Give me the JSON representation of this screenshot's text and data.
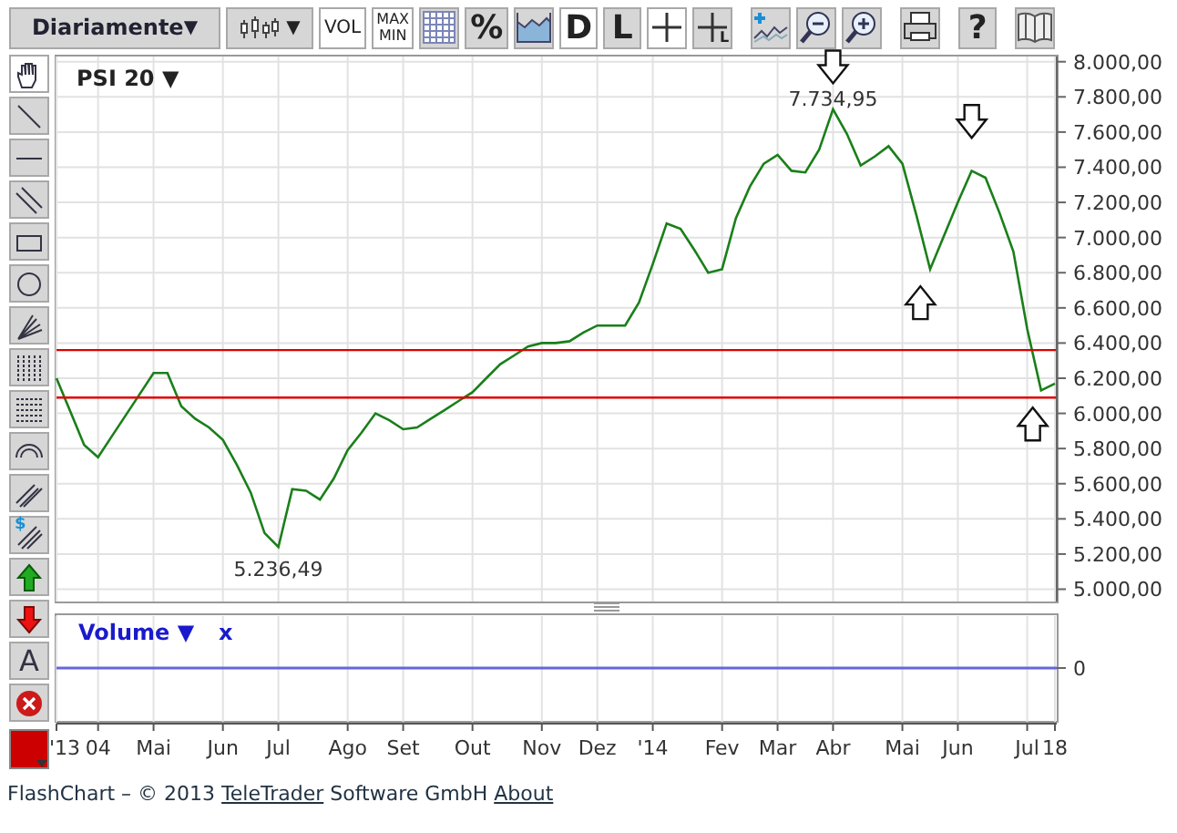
{
  "toolbar": [
    {
      "kind": "dropdown",
      "label": "Diariamente",
      "arrow": "▼",
      "on": false
    },
    {
      "kind": "chart_type",
      "arrow": "▼",
      "on": false
    },
    {
      "kind": "text",
      "label": "VOL",
      "on": true
    },
    {
      "kind": "text2",
      "label": "MAX",
      "label2": "MIN",
      "on": true
    },
    {
      "kind": "grid",
      "on": false
    },
    {
      "kind": "text",
      "label": "%",
      "on": false
    },
    {
      "kind": "area",
      "on": false
    },
    {
      "kind": "text",
      "label": "D",
      "on": true
    },
    {
      "kind": "text",
      "label": "L",
      "on": false
    },
    {
      "kind": "crosshair",
      "on": true
    },
    {
      "kind": "crosshair_l",
      "label": "L",
      "on": false
    },
    {
      "kind": "gap"
    },
    {
      "kind": "add_indicator",
      "on": false
    },
    {
      "kind": "zoom_out",
      "on": false
    },
    {
      "kind": "zoom_in",
      "on": false
    },
    {
      "kind": "gap"
    },
    {
      "kind": "print",
      "on": false
    },
    {
      "kind": "gap"
    },
    {
      "kind": "text",
      "label": "?",
      "on": false
    },
    {
      "kind": "gap"
    },
    {
      "kind": "book",
      "on": false
    }
  ],
  "drawing_tools": [
    {
      "kind": "hand",
      "selected": true
    },
    {
      "kind": "line",
      "selected": false
    },
    {
      "kind": "hline",
      "selected": false
    },
    {
      "kind": "channel",
      "selected": false
    },
    {
      "kind": "rect",
      "selected": false
    },
    {
      "kind": "circle",
      "selected": false
    },
    {
      "kind": "fan",
      "selected": false
    },
    {
      "kind": "vlines",
      "selected": false
    },
    {
      "kind": "hlines",
      "selected": false
    },
    {
      "kind": "arc",
      "selected": false
    },
    {
      "kind": "parallel",
      "selected": false
    },
    {
      "kind": "parallel_s",
      "label": "$",
      "selected": false
    },
    {
      "kind": "up",
      "selected": false
    },
    {
      "kind": "down",
      "selected": false
    },
    {
      "kind": "text",
      "label": "A",
      "selected": false
    },
    {
      "kind": "delete",
      "selected": false
    }
  ],
  "color_picker": {
    "color": "#cc0000"
  },
  "chart": {
    "title_arrow": "▼",
    "chart_data": {
      "type": "line",
      "ylim": [
        4930,
        8040
      ],
      "categories": [
        "'13",
        null,
        null,
        "04",
        null,
        null,
        null,
        "Mai",
        null,
        null,
        null,
        null,
        "Jun",
        null,
        null,
        null,
        "Jul",
        null,
        null,
        null,
        null,
        "Ago",
        null,
        null,
        null,
        "Set",
        null,
        null,
        null,
        null,
        "Out",
        null,
        null,
        null,
        null,
        "Nov",
        null,
        null,
        null,
        "Dez",
        null,
        null,
        null,
        "'14",
        null,
        null,
        null,
        null,
        "Fev",
        null,
        null,
        null,
        "Mar",
        null,
        null,
        null,
        "Abr",
        null,
        null,
        null,
        null,
        "Mai",
        null,
        null,
        null,
        "Jun",
        null,
        null,
        null,
        null,
        "Jul",
        null,
        "18"
      ],
      "yticks": [
        {
          "value": 8000,
          "label": "8.000,00"
        },
        {
          "value": 7800,
          "label": "7.800,00"
        },
        {
          "value": 7600,
          "label": "7.600,00"
        },
        {
          "value": 7400,
          "label": "7.400,00"
        },
        {
          "value": 7200,
          "label": "7.200,00"
        },
        {
          "value": 7000,
          "label": "7.000,00"
        },
        {
          "value": 6800,
          "label": "6.800,00"
        },
        {
          "value": 6600,
          "label": "6.600,00"
        },
        {
          "value": 6400,
          "label": "6.400,00"
        },
        {
          "value": 6200,
          "label": "6.200,00"
        },
        {
          "value": 6000,
          "label": "6.000,00"
        },
        {
          "value": 5800,
          "label": "5.800,00"
        },
        {
          "value": 5600,
          "label": "5.600,00"
        },
        {
          "value": 5400,
          "label": "5.400,00"
        },
        {
          "value": 5200,
          "label": "5.200,00"
        },
        {
          "value": 5000,
          "label": "5.000,00"
        }
      ],
      "series": [
        {
          "name": "PSI 20",
          "color": "#1a7f1a",
          "values": [
            6200,
            6010,
            5820,
            5750,
            5870,
            5990,
            6110,
            6230,
            6230,
            6040,
            5970,
            5920,
            5850,
            5710,
            5550,
            5320,
            5240,
            5570,
            5560,
            5510,
            5630,
            5790,
            5890,
            6000,
            5960,
            5910,
            5920,
            5970,
            6020,
            6070,
            6120,
            6200,
            6280,
            6330,
            6380,
            6400,
            6400,
            6410,
            6460,
            6500,
            6500,
            6500,
            6630,
            6850,
            7080,
            7050,
            6930,
            6800,
            6820,
            7110,
            7290,
            7420,
            7470,
            7380,
            7370,
            7500,
            7730,
            7590,
            7410,
            7460,
            7520,
            7420,
            7130,
            6820,
            7010,
            7200,
            7380,
            7340,
            7140,
            6920,
            6480,
            6130,
            6170
          ]
        }
      ],
      "grid": true,
      "ref_lines": [
        {
          "axis": "y",
          "value": 6360,
          "color": "#dd0000"
        },
        {
          "axis": "y",
          "value": 6090,
          "color": "#dd0000"
        }
      ],
      "annotations": [
        {
          "x": "Abr",
          "y": 7730,
          "text": "7.734,95"
        },
        {
          "x": "Jul",
          "y": 5240,
          "text": "5.236,49"
        }
      ]
    }
  },
  "volume": {
    "title": "Volume",
    "title_arrow": "▼",
    "close": "x",
    "zero_label": "0"
  },
  "footer": {
    "prefix": "FlashChart – © 2013",
    "link1": "TeleTrader",
    "middle": "Software GmbH",
    "link2": "About"
  }
}
